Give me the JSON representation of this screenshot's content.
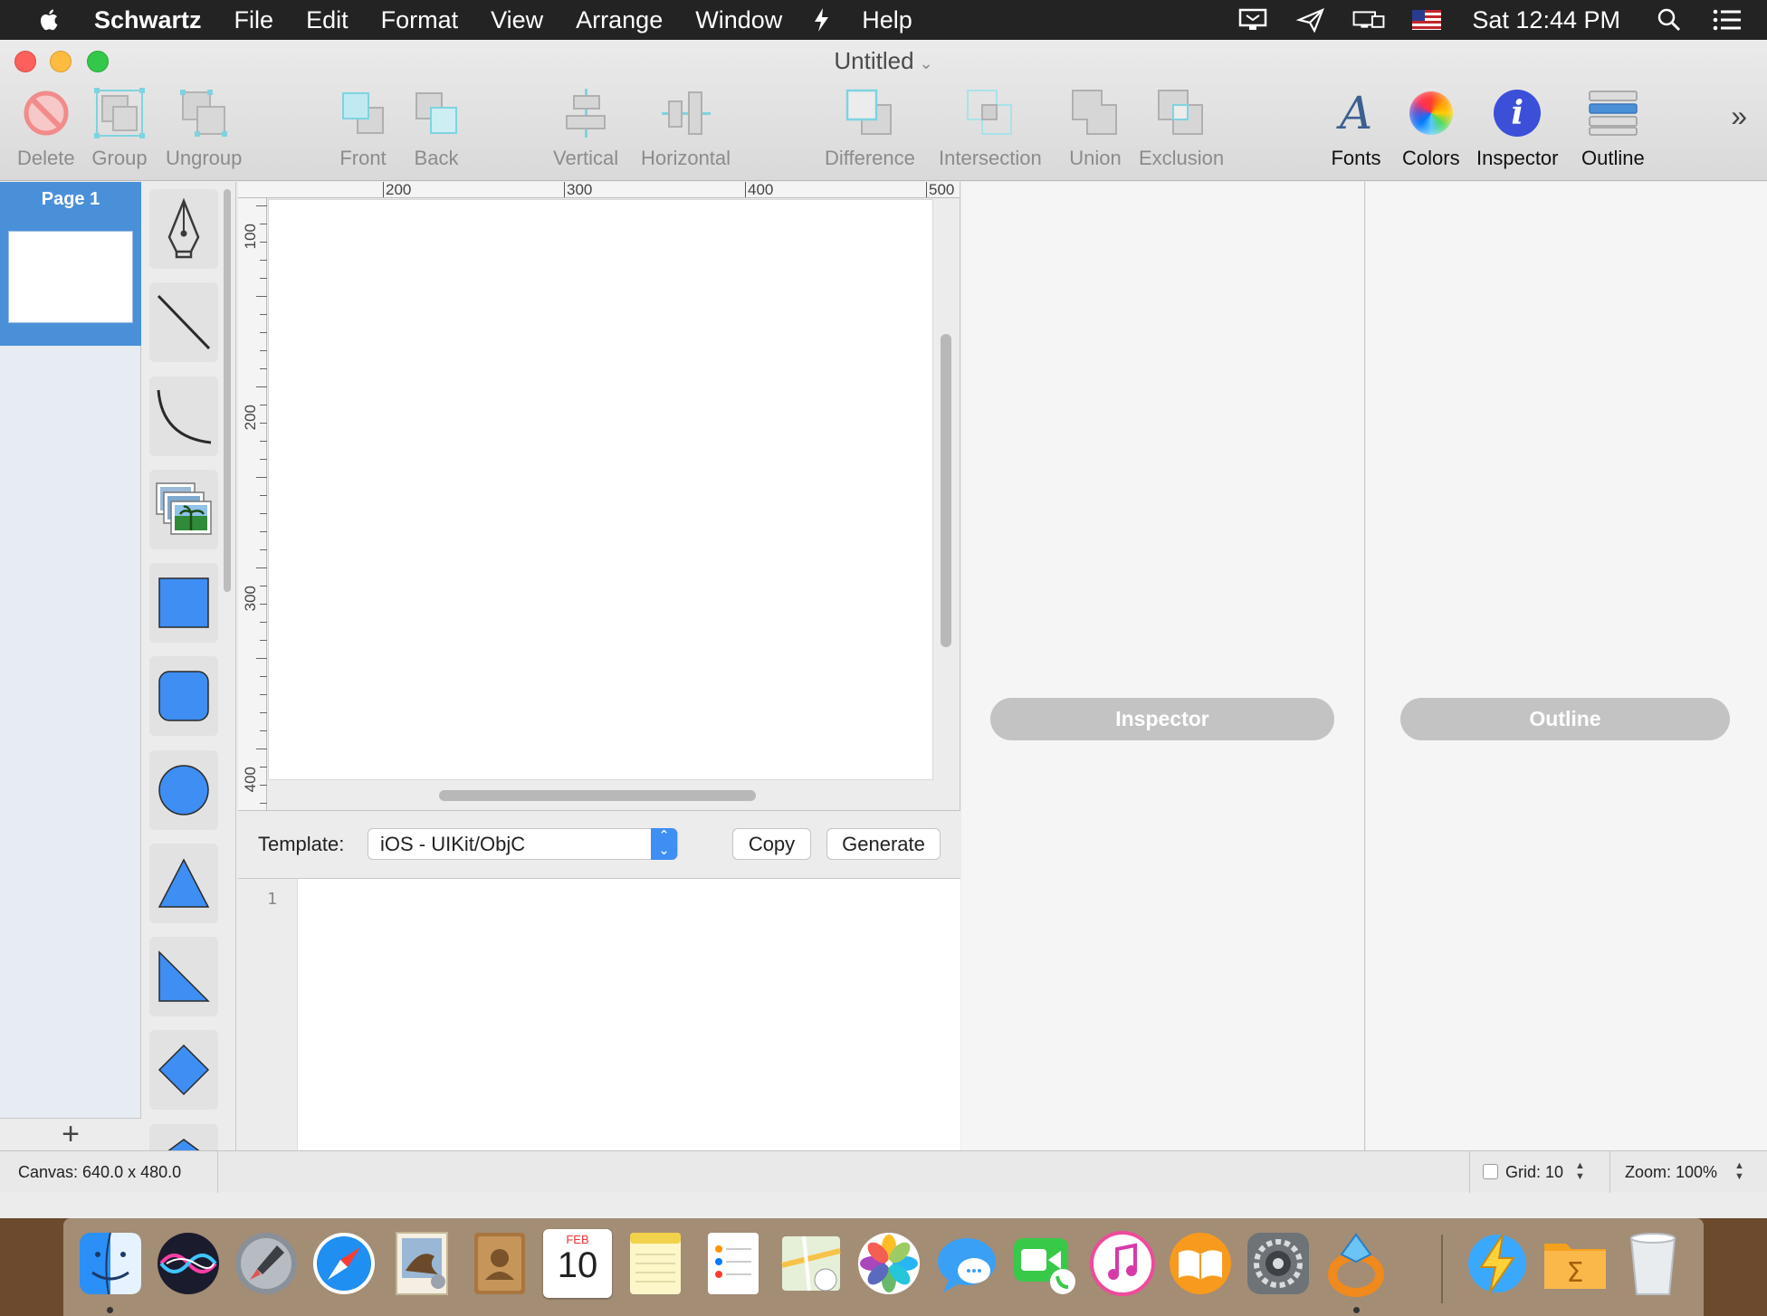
{
  "menubar": {
    "app": "Schwartz",
    "items": [
      "File",
      "Edit",
      "Format",
      "View",
      "Arrange",
      "Window",
      "Help"
    ],
    "clock": "Sat 12:44 PM"
  },
  "window": {
    "title": "Untitled"
  },
  "toolbar": {
    "delete": "Delete",
    "group": "Group",
    "ungroup": "Ungroup",
    "front": "Front",
    "back": "Back",
    "vertical": "Vertical",
    "horizontal": "Horizontal",
    "difference": "Difference",
    "intersection": "Intersection",
    "union": "Union",
    "exclusion": "Exclusion",
    "fonts": "Fonts",
    "colors": "Colors",
    "inspector": "Inspector",
    "outline": "Outline"
  },
  "pages": {
    "items": [
      {
        "label": "Page 1"
      }
    ],
    "add": "+"
  },
  "tools": [
    "pen-icon",
    "line-icon",
    "arc-icon",
    "image-icon",
    "rectangle-icon",
    "rounded-rectangle-icon",
    "circle-icon",
    "triangle-icon",
    "right-triangle-icon",
    "diamond-icon",
    "pentagon-icon"
  ],
  "rulers": {
    "horizontal": [
      "200",
      "300",
      "400",
      "500"
    ],
    "vertical": [
      "100",
      "200",
      "300",
      "400"
    ]
  },
  "code_panel": {
    "template_label": "Template:",
    "template_value": "iOS - UIKit/ObjC",
    "copy": "Copy",
    "generate": "Generate",
    "line_number": "1"
  },
  "panels": {
    "inspector": "Inspector",
    "outline": "Outline"
  },
  "status": {
    "canvas": "Canvas: 640.0 x 480.0",
    "grid": "Grid: 10",
    "grid_checked": false,
    "zoom": "Zoom:  100%"
  },
  "dock": {
    "apps": [
      "finder-icon",
      "siri-icon",
      "launchpad-icon",
      "safari-icon",
      "mail-icon",
      "contacts-icon",
      "calendar-icon",
      "notes-icon",
      "reminders-icon",
      "maps-icon",
      "photos-icon",
      "messages-icon",
      "facetime-icon",
      "itunes-icon",
      "ibooks-icon",
      "system-preferences-icon",
      "schwartz-icon",
      "downloads-icon",
      "documents-icon",
      "trash-icon"
    ],
    "calendar_month": "FEB",
    "calendar_day": "10"
  },
  "colors": {
    "accent": "#4a90d9",
    "shape_fill": "#3e8ef3"
  }
}
